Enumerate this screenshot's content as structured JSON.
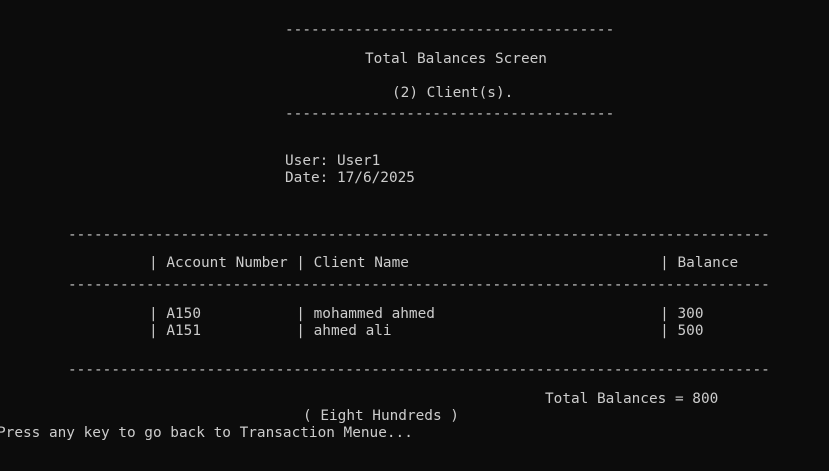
{
  "screen": {
    "top_separator": "--------------------------------------",
    "title": "Total Balances Screen",
    "client_count": "(2) Client(s).",
    "bottom_separator": "--------------------------------------"
  },
  "session": {
    "user_line": "User: User1",
    "date_line": "Date: 17/6/2025"
  },
  "table": {
    "separator": "---------------------------------------------------------------------------------",
    "header": "| Account Number | Client Name                             | Balance",
    "rows": [
      "| A150           | mohammed ahmed                          | 300",
      "| A151           | ahmed ali                               | 500"
    ]
  },
  "summary": {
    "total_line": "Total Balances = 800",
    "total_words": "( Eight Hundreds )",
    "prompt": "Press any key to go back to Transaction Menue..."
  }
}
